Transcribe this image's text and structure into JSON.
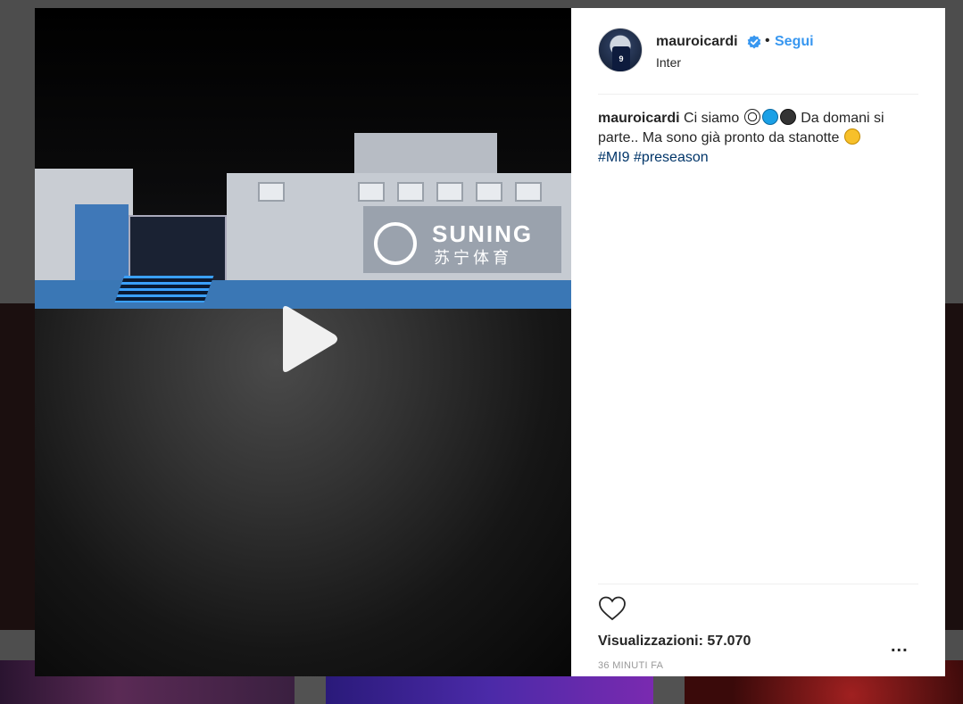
{
  "post": {
    "username": "mauroicardi",
    "separator": "•",
    "follow_label": "Segui",
    "location": "Inter",
    "avatar_jersey_number": "9",
    "caption": {
      "username": "mauroicardi",
      "text_part1": "Ci siamo",
      "text_part2": "Da domani si parte.. Ma sono già pronto da stanotte",
      "hashtag1": "#MI9",
      "hashtag2": "#preseason"
    },
    "views_label": "Visualizzazioni:",
    "views_count": "57.070",
    "more_label": "...",
    "timestamp": "36 MINUTI FA"
  },
  "video": {
    "sign_text": "SUNING",
    "sign_text_cn": "苏宁体育"
  },
  "colors": {
    "link_blue": "#3897f0",
    "hashtag_blue": "#003569",
    "text": "#262626",
    "muted": "#999999"
  },
  "icons": {
    "play": "play-icon",
    "verified": "verified-badge-icon",
    "heart": "heart-icon",
    "more": "more-options-icon"
  }
}
